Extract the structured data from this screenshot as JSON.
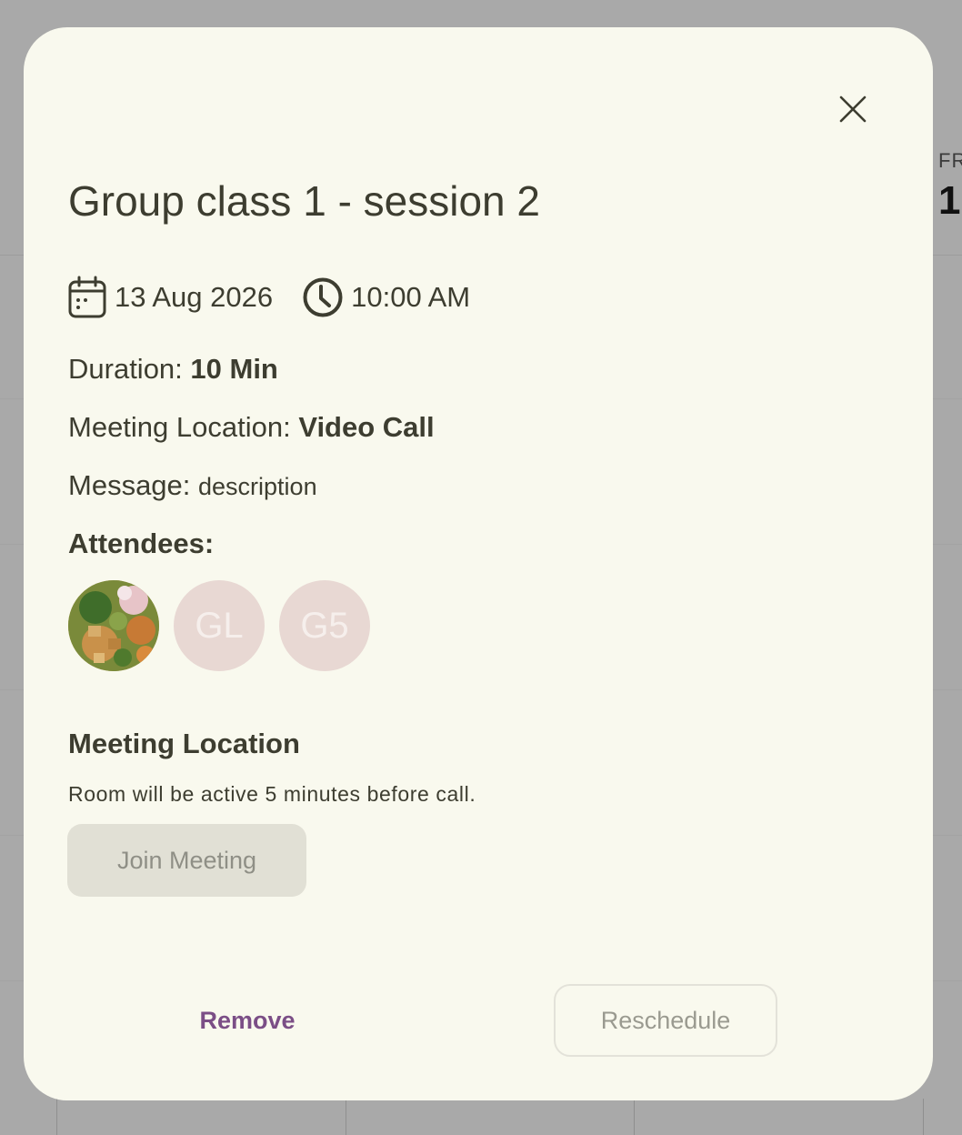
{
  "background": {
    "day_label": "FR",
    "date_label": "1"
  },
  "dialog": {
    "title": "Group class 1 - session 2",
    "date": "13 Aug 2026",
    "time": "10:00 AM",
    "duration_label": "Duration: ",
    "duration_value": "10 Min",
    "location_label": "Meeting Location: ",
    "location_value": "Video Call",
    "message_label": "Message: ",
    "message_value": "description",
    "attendees_label": "Attendees:",
    "attendees": [
      {
        "type": "photo",
        "initials": ""
      },
      {
        "type": "initials",
        "initials": "GL"
      },
      {
        "type": "initials",
        "initials": "G5"
      }
    ],
    "meeting_section_title": "Meeting Location",
    "meeting_note": "Room will be active 5 minutes before call.",
    "join_label": "Join Meeting",
    "remove_label": "Remove",
    "reschedule_label": "Reschedule"
  },
  "colors": {
    "dialog_bg": "#f9f9ee",
    "overlay": "#a9a9a9",
    "text": "#3d3d30",
    "accent": "#7b4e86",
    "avatar_bg": "#e8d8d3",
    "disabled_bg": "#e1e0d5"
  },
  "icons": [
    "close-icon",
    "calendar-icon",
    "clock-icon"
  ]
}
